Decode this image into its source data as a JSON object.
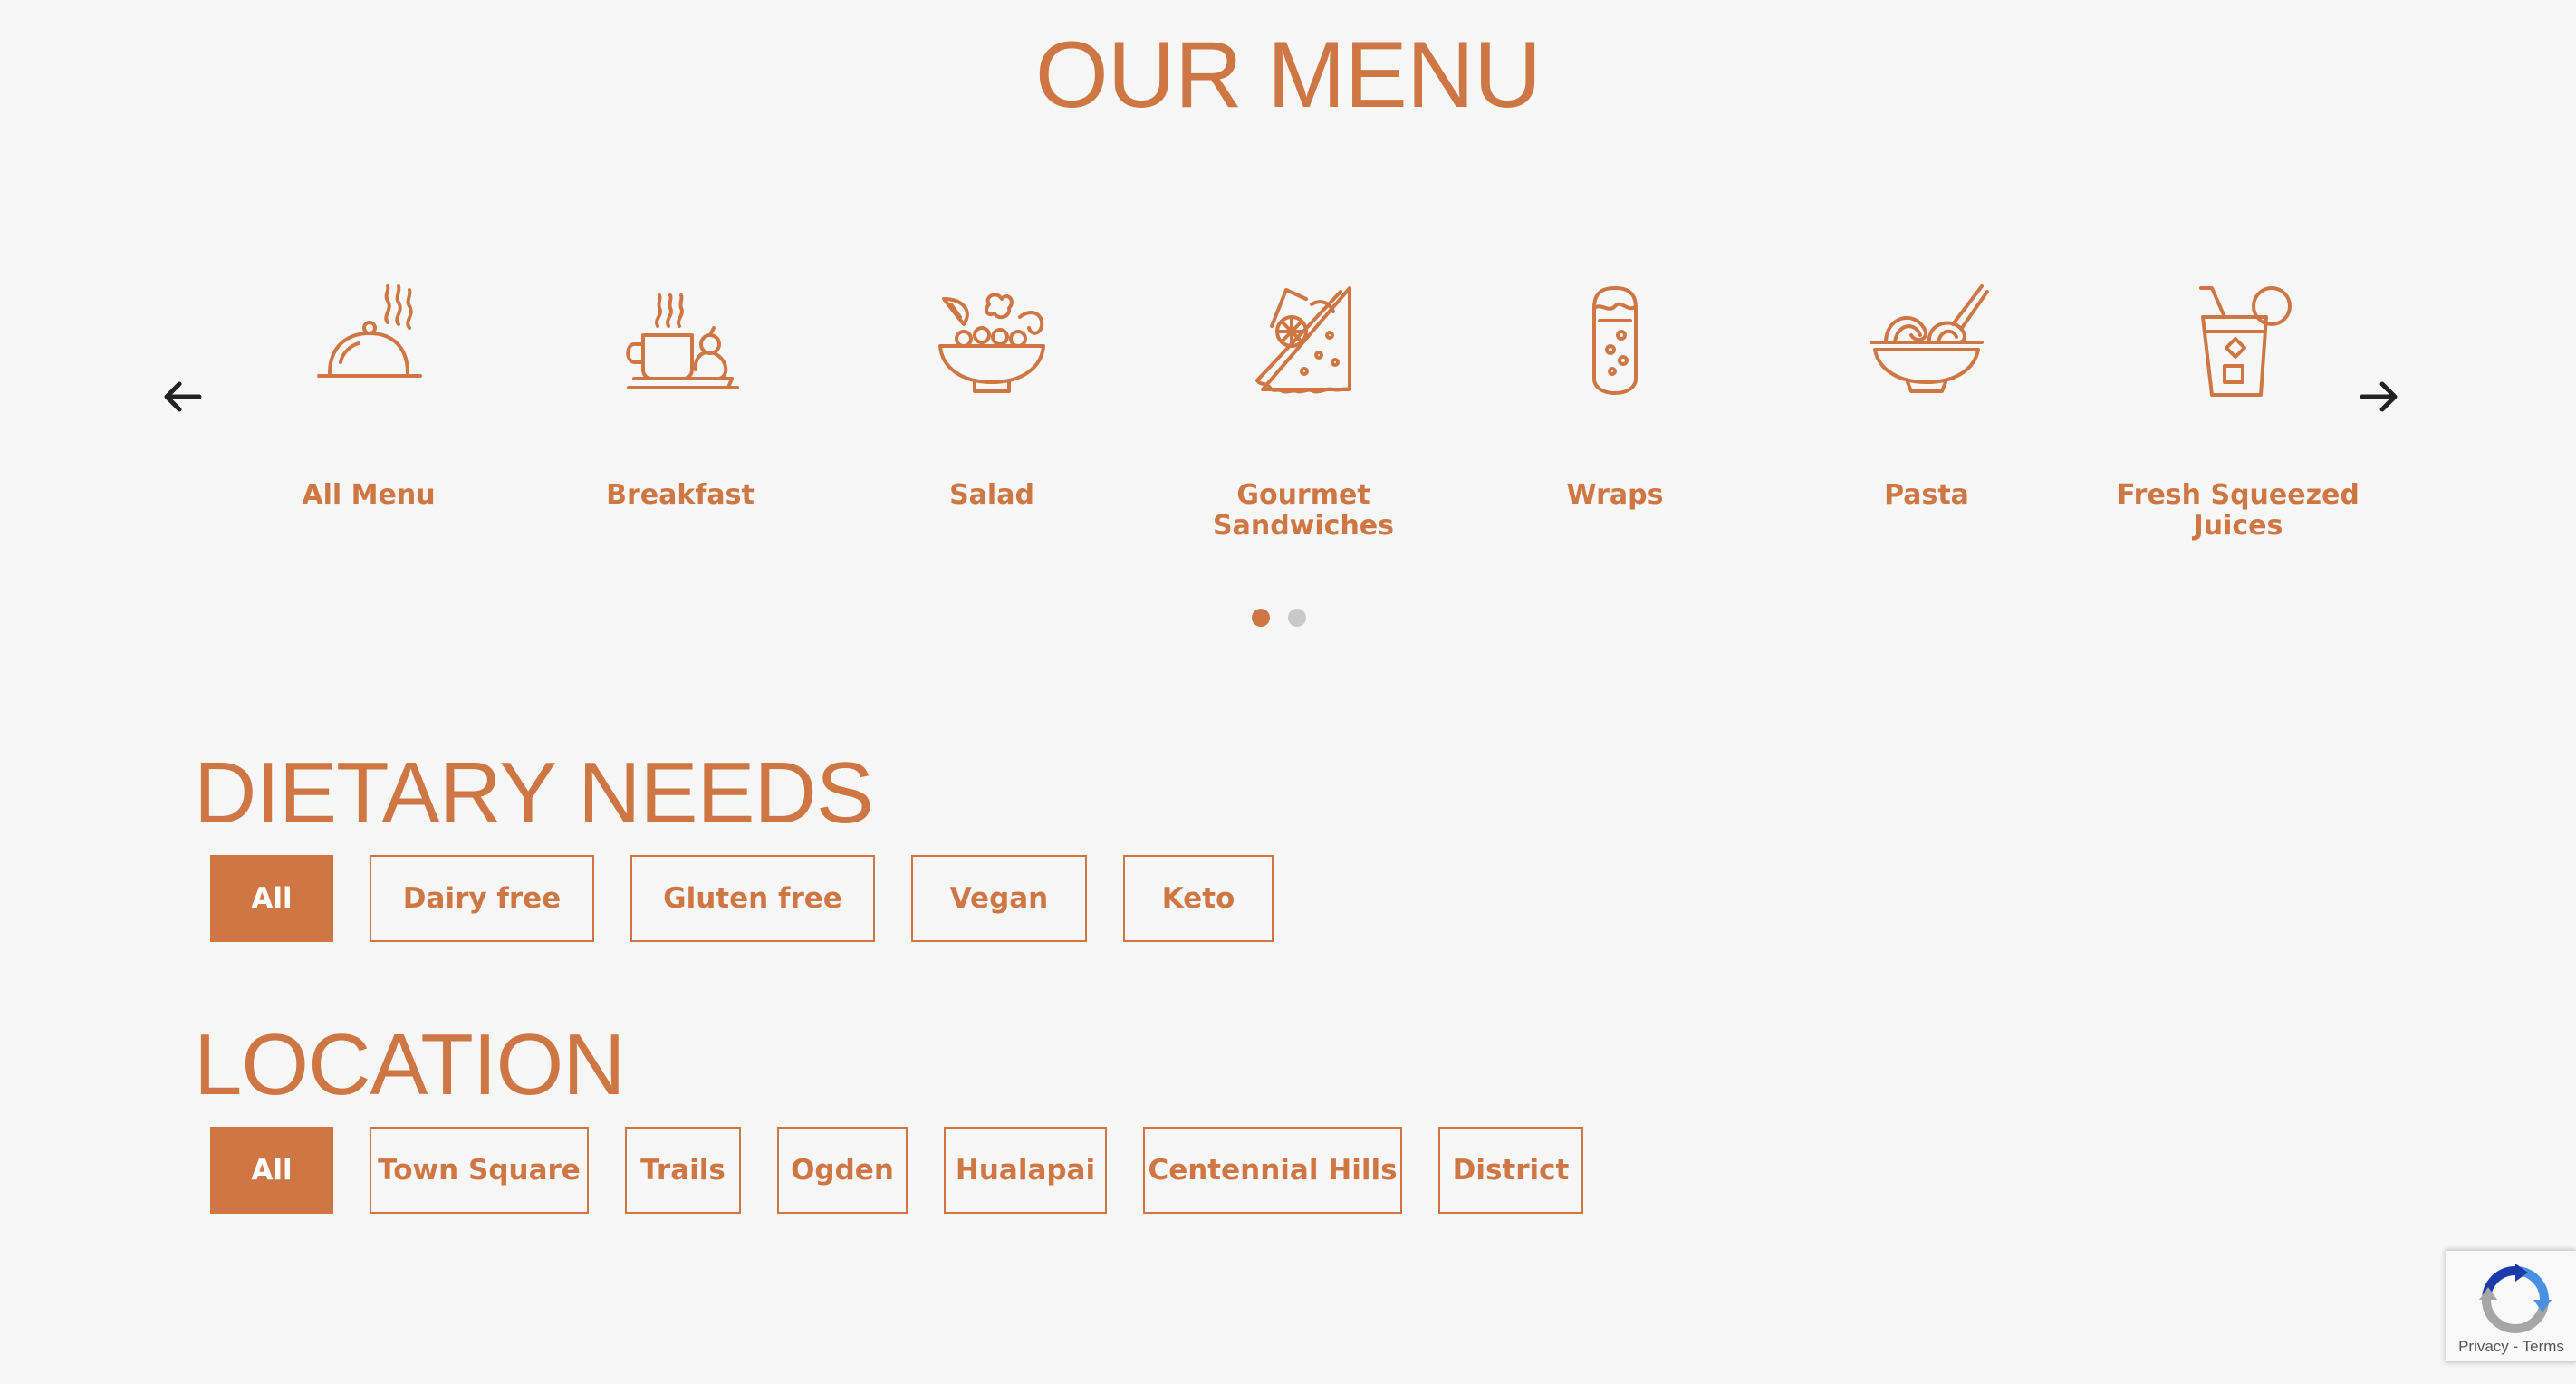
{
  "colors": {
    "accent": "#cf7744",
    "background": "#f7f7f7",
    "dot_inactive": "#c9c9c9"
  },
  "title": "OUR MENU",
  "carousel": {
    "prev_icon": "arrow-left-icon",
    "next_icon": "arrow-right-icon",
    "categories": [
      {
        "label": "All Menu",
        "icon": "cloche-icon"
      },
      {
        "label": "Breakfast",
        "icon": "breakfast-mug-icon"
      },
      {
        "label": "Salad",
        "icon": "salad-bowl-icon"
      },
      {
        "label": "Gourmet Sandwiches",
        "icon": "sandwich-icon"
      },
      {
        "label": "Wraps",
        "icon": "wrap-icon"
      },
      {
        "label": "Pasta",
        "icon": "noodle-bowl-icon"
      },
      {
        "label": "Fresh Squeezed Juices",
        "icon": "juice-cup-icon"
      }
    ],
    "pagination": {
      "pages": 2,
      "current": 1
    }
  },
  "dietary": {
    "heading": "DIETARY NEEDS",
    "options": [
      "All",
      "Dairy free",
      "Gluten free",
      "Vegan",
      "Keto"
    ],
    "selected": "All"
  },
  "location": {
    "heading": "LOCATION",
    "options": [
      "All",
      "Town Square",
      "Trails",
      "Ogden",
      "Hualapai",
      "Centennial Hills",
      "District"
    ],
    "selected": "All"
  },
  "recaptcha": {
    "privacy": "Privacy",
    "separator": " - ",
    "terms": "Terms"
  }
}
